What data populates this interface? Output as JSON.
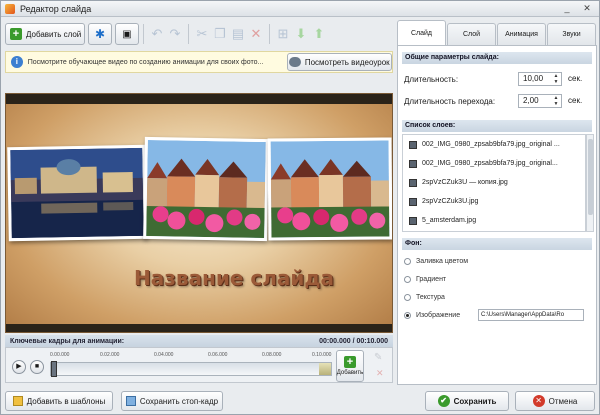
{
  "window": {
    "title": "Редактор слайда"
  },
  "toolbar": {
    "add_layer_label": "Добавить слой"
  },
  "info": {
    "text": "Посмотрите обучающее видео по созданию анимации для своих фото...",
    "video_button_label": "Посмотреть видеоурок"
  },
  "slide": {
    "title_text": "Название слайда"
  },
  "timeline": {
    "header_label": "Ключевые кадры для анимации:",
    "time_readout": "00:00.000 / 00:10.000",
    "ruler_ticks": [
      "0.00.000",
      "0.02.000",
      "0.04.000",
      "0.06.000",
      "0.08.000",
      "0.10.000"
    ],
    "add_button_label": "Добавить"
  },
  "bottom": {
    "add_templates_label": "Добавить в шаблоны",
    "save_frame_label": "Сохранить стоп-кадр",
    "save_label": "Сохранить",
    "cancel_label": "Отмена"
  },
  "tabs": [
    "Слайд",
    "Слой",
    "Анимация",
    "Звуки"
  ],
  "slide_params": {
    "header": "Общие параметры слайда:",
    "duration_label": "Длительность:",
    "duration_value": "10,00",
    "transition_label": "Длительность перехода:",
    "transition_value": "2,00",
    "unit": "сек."
  },
  "layers": {
    "header": "Список слоев:",
    "items": [
      "002_IMG_0980_zpsab9bfa79.jpg_original ...",
      "002_IMG_0980_zpsab9bfa79.jpg_original...",
      "2spVzCZuk3U — копия.jpg",
      "2spVzCZuk3U.jpg",
      "5_amsterdam.jpg"
    ]
  },
  "background": {
    "header": "Фон:",
    "options": [
      "Заливка цветом",
      "Градиент",
      "Текстура",
      "Изображение"
    ],
    "selected_index": 3,
    "path_value": "C:\\Users\\Manager\\AppData\\Ro"
  },
  "colors": {
    "accent": "#3c7fd1",
    "save_green": "#3a9a2c",
    "cancel_red": "#d23a2a",
    "title_brown": "#9b5a38"
  }
}
